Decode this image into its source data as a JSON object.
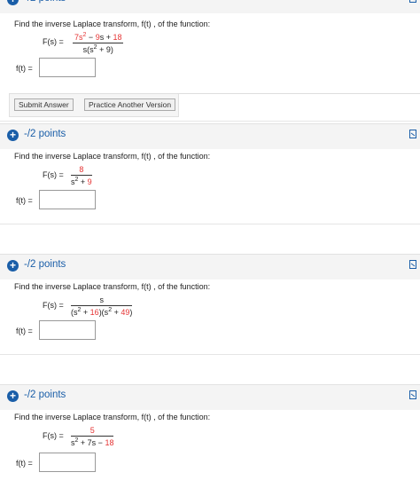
{
  "common": {
    "points": "-/2 points",
    "prompt": "Find the inverse Laplace transform,  f(t) , of the function:",
    "F_label": "F(s) =",
    "f_label": "f(t) ="
  },
  "buttons": {
    "submit": "Submit Answer",
    "practice": "Practice Another Version"
  },
  "q1": {
    "num_a": "7s",
    "num_b": " − ",
    "num_c": "9",
    "num_d": "s + ",
    "num_e": "18",
    "den_a": "s(s",
    "den_b": " + 9)"
  },
  "q2": {
    "num": "8",
    "den_a": "s",
    "den_b": " + ",
    "den_c": "9"
  },
  "q3": {
    "num": "s",
    "den_a": "(s",
    "den_b": " + ",
    "den_c": "16",
    "den_d": ")(s",
    "den_e": " + ",
    "den_f": "49",
    "den_g": ")"
  },
  "q4": {
    "num": "5",
    "den_a": "s",
    "den_b": " + 7s − ",
    "den_c": "18"
  },
  "colors": {
    "accent": "#1a5ea8",
    "highlight": "#e53434"
  }
}
